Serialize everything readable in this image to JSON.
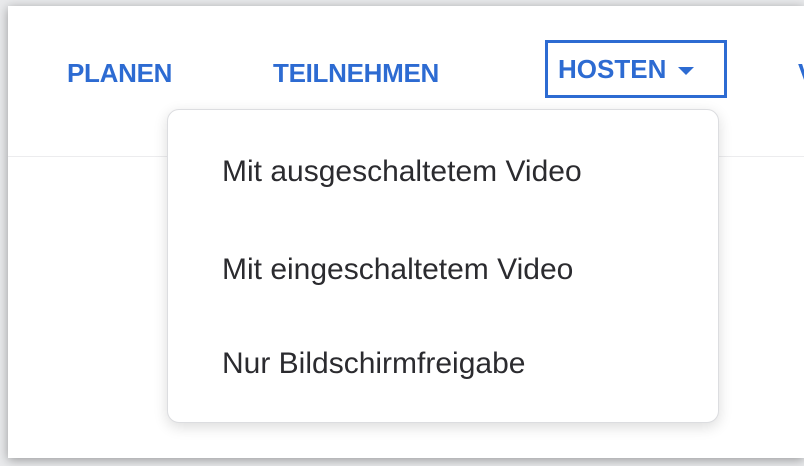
{
  "nav": {
    "items": [
      {
        "label": "PLANEN"
      },
      {
        "label": "TEILNEHMEN"
      },
      {
        "label": "HOSTEN"
      },
      {
        "label": "V"
      }
    ]
  },
  "dropdown": {
    "items": [
      {
        "label": "Mit ausgeschaltetem Video"
      },
      {
        "label": "Mit eingeschaltetem Video"
      },
      {
        "label": "Nur Bildschirmfreigabe"
      }
    ]
  },
  "colors": {
    "accent": "#2d6bd2",
    "menu_text": "#2b2b2f"
  }
}
